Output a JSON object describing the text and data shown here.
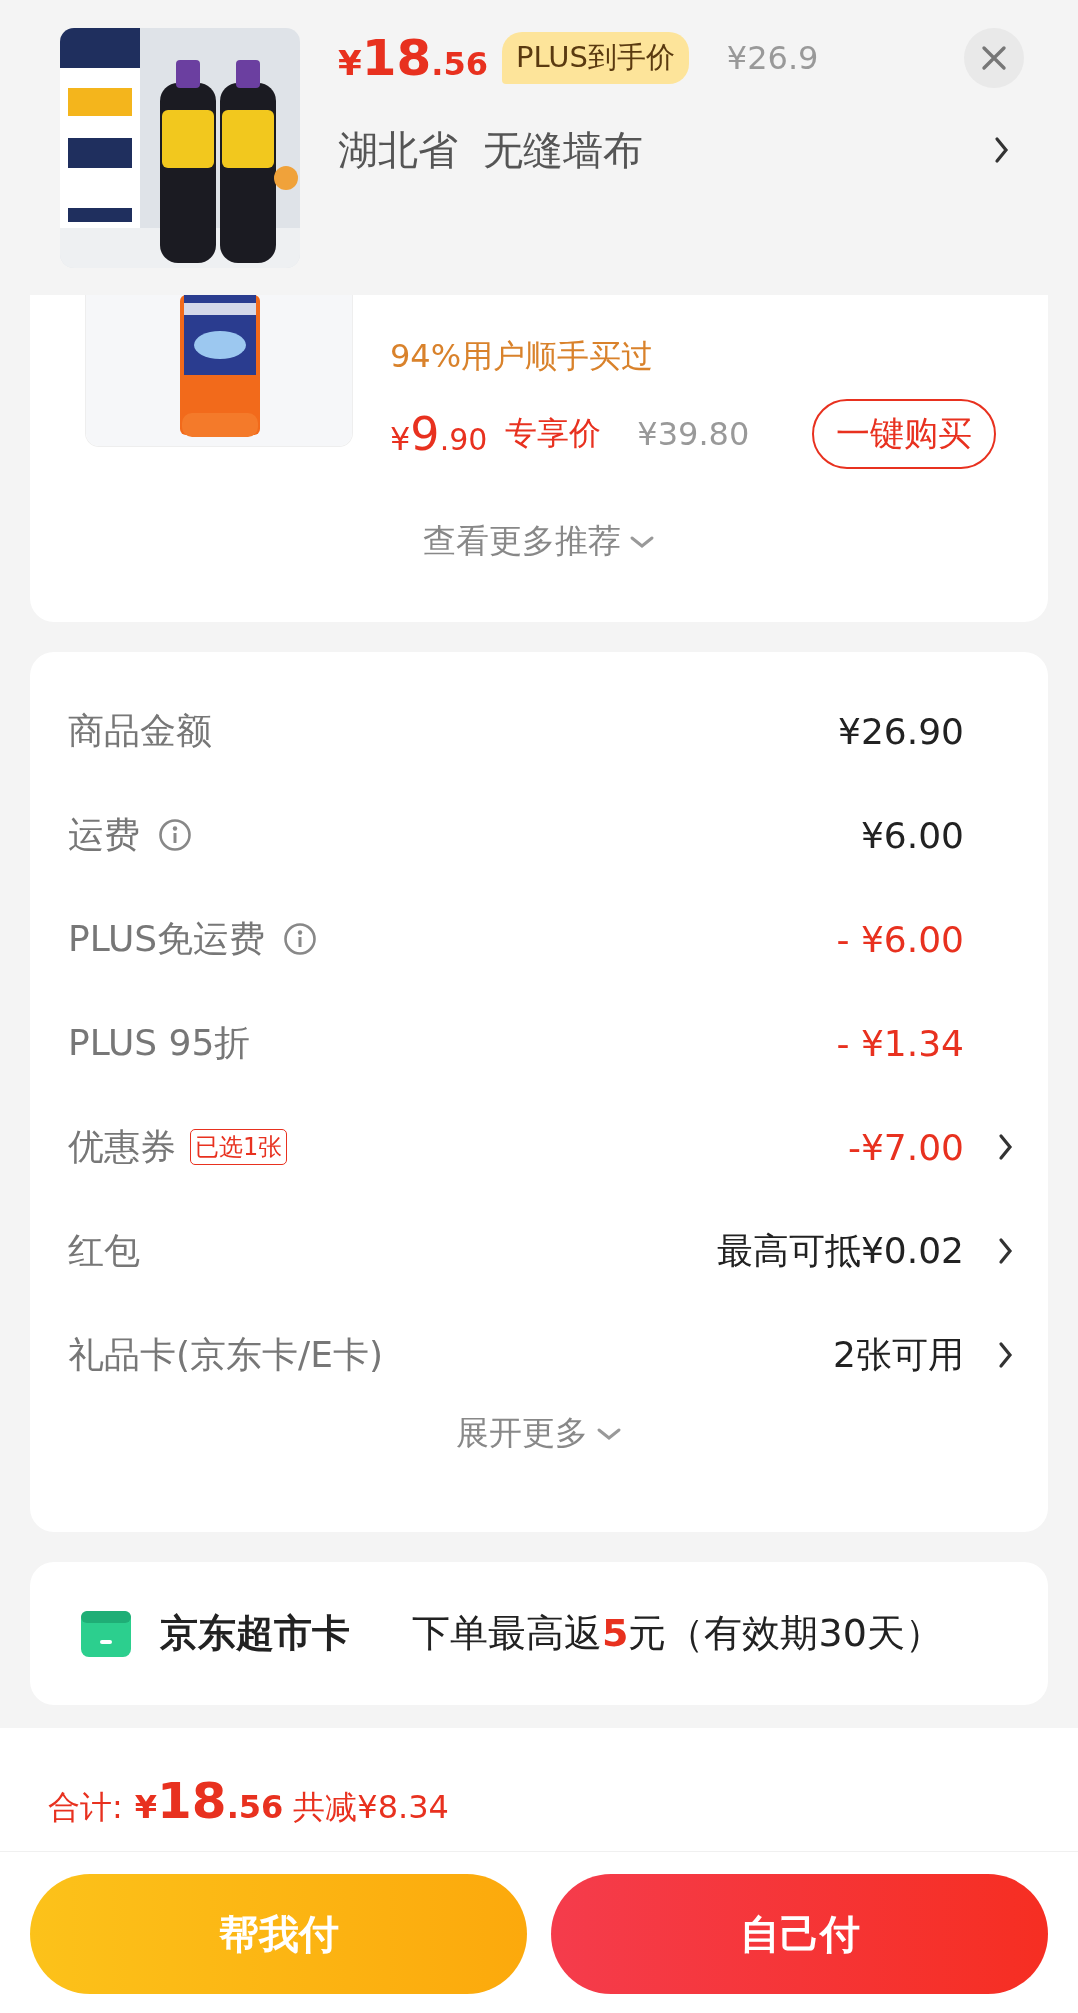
{
  "header": {
    "price": "¥18.56",
    "price_tag": "PLUS到手价",
    "original_price": "¥26.9",
    "address": "湖北省  无缝墙布"
  },
  "recommendation": {
    "note": "94%用户顺手买过",
    "price": "¥9.90",
    "price_label": "专享价",
    "original_price": "¥39.80",
    "buy_button": "一键购买",
    "more_link": "查看更多推荐"
  },
  "fees": {
    "rows": [
      {
        "label": "商品金额",
        "value": "¥26.90",
        "discount": false,
        "info": false,
        "chevron": false
      },
      {
        "label": "运费",
        "value": "¥6.00",
        "discount": false,
        "info": true,
        "chevron": false
      },
      {
        "label": "PLUS免运费",
        "value": "- ¥6.00",
        "discount": true,
        "info": true,
        "chevron": false
      },
      {
        "label": "PLUS 95折",
        "value": "- ¥1.34",
        "discount": true,
        "info": false,
        "chevron": false
      },
      {
        "label": "优惠券",
        "tag": "已选1张",
        "value": "-¥7.00",
        "discount": true,
        "info": false,
        "chevron": true
      },
      {
        "label": "红包",
        "value": "最高可抵¥0.02",
        "discount": false,
        "info": false,
        "chevron": true
      },
      {
        "label": "礼品卡(京东卡/E卡)",
        "value": "2张可用",
        "discount": false,
        "info": false,
        "chevron": true
      }
    ],
    "expand_link": "展开更多"
  },
  "market_card": {
    "title": "京东超市卡",
    "text": "下单最高返**5**元（有效期30天）"
  },
  "pay_bar": {
    "total_label": "合计:",
    "total": "¥18.56",
    "saved": "共减¥8.34",
    "buttons": [
      {
        "label": "帮我付",
        "kind": "friend"
      },
      {
        "label": "自己付",
        "kind": "self"
      }
    ]
  }
}
